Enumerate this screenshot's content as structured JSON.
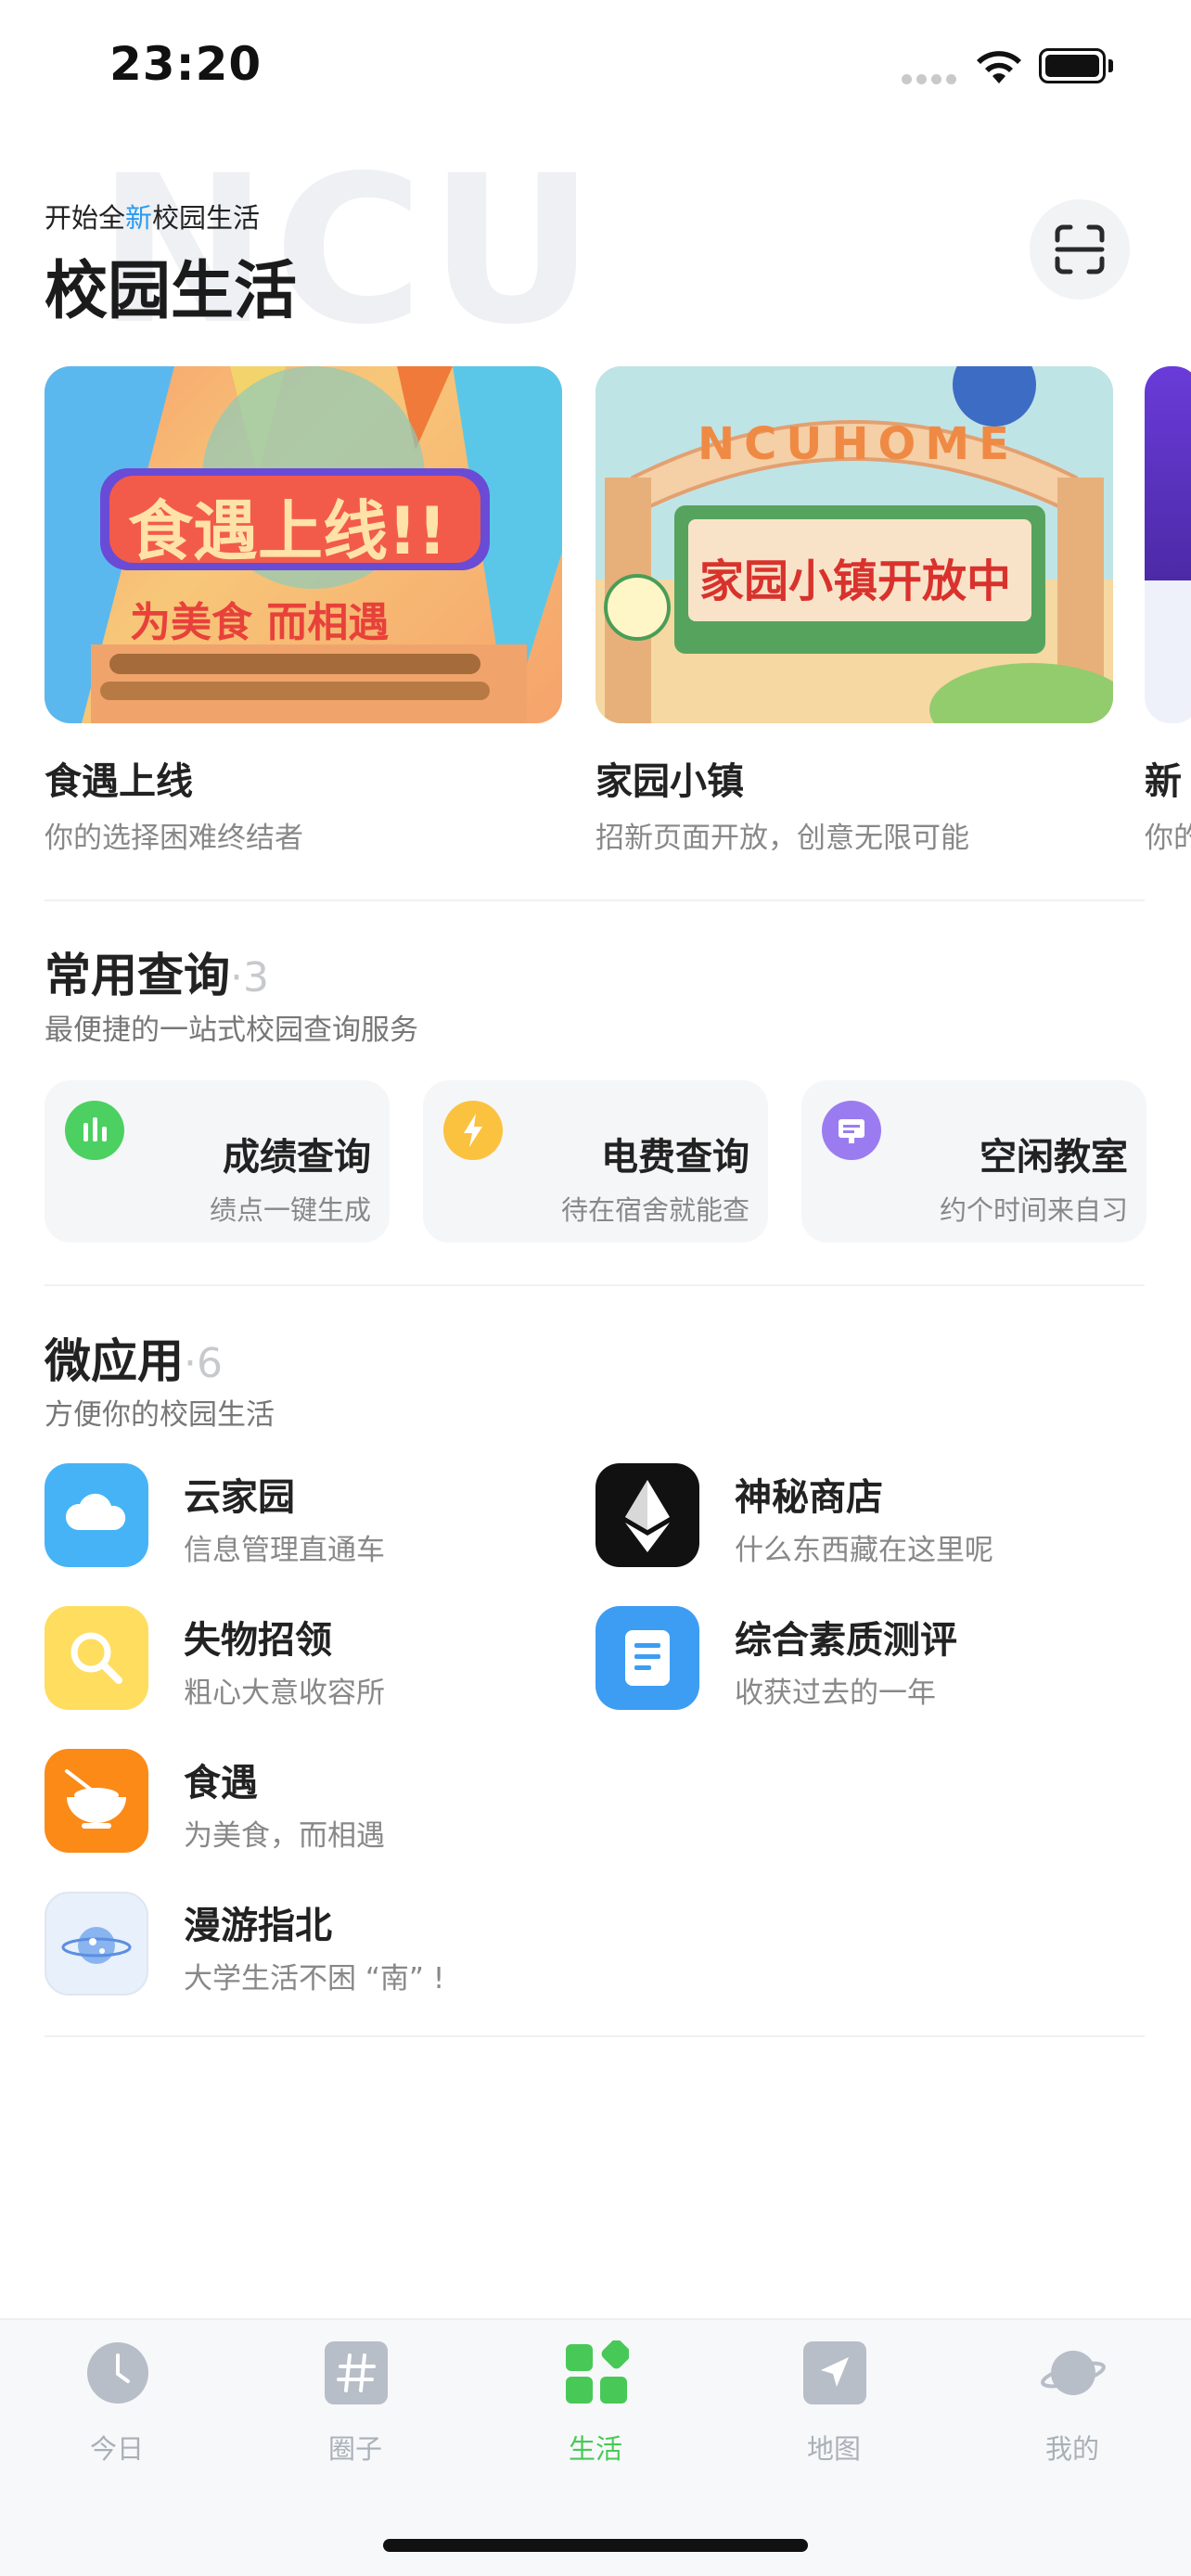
{
  "status_bar": {
    "time": "23:20"
  },
  "header": {
    "subtitle_pre": "开始全",
    "subtitle_highlight": "新",
    "subtitle_post": "校园生活",
    "watermark": "NCU",
    "title": "校园生活"
  },
  "banners": [
    {
      "title": "食遇上线",
      "subtitle": "你的选择困难终结者",
      "art_text_1": "食遇上线!!",
      "art_text_2": "为美食 而相遇"
    },
    {
      "title": "家园小镇",
      "subtitle": "招新页面开放，创意无限可能",
      "art_text_1": "NCUHOME",
      "art_text_2": "家园小镇开放中"
    },
    {
      "title": "新",
      "subtitle": "你的"
    }
  ],
  "queries": {
    "title": "常用查询",
    "count": "·3",
    "subtitle": "最便捷的一站式校园查询服务",
    "items": [
      {
        "title": "成绩查询",
        "subtitle": "绩点一键生成",
        "icon": "bar-chart-icon",
        "color": "#4cd062"
      },
      {
        "title": "电费查询",
        "subtitle": "待在宿舍就能查",
        "icon": "lightning-icon",
        "color": "#fbc23f"
      },
      {
        "title": "空闲教室",
        "subtitle": "约个时间来自习",
        "icon": "classroom-icon",
        "color": "#9b7cf0"
      }
    ]
  },
  "micro_apps": {
    "title": "微应用",
    "count": "·6",
    "subtitle": "方便你的校园生活",
    "items": [
      {
        "name": "云家园",
        "subtitle": "信息管理直通车",
        "icon": "cloud-icon",
        "color": "#46b3f6"
      },
      {
        "name": "神秘商店",
        "subtitle": "什么东西藏在这里呢",
        "icon": "ethereum-icon",
        "color": "#111111"
      },
      {
        "name": "失物招领",
        "subtitle": "粗心大意收容所",
        "icon": "search-icon",
        "color": "#fedd5f"
      },
      {
        "name": "综合素质测评",
        "subtitle": "收获过去的一年",
        "icon": "document-icon",
        "color": "#3d9df3"
      },
      {
        "name": "食遇",
        "subtitle": "为美食，而相遇",
        "icon": "bowl-icon",
        "color": "#fb8a17"
      },
      {
        "name": "漫游指北",
        "subtitle": "大学生活不困 “南” !",
        "icon": "planet-icon",
        "color": "#e8f0fc"
      }
    ]
  },
  "tabs": [
    {
      "label": "今日",
      "icon": "clock-icon",
      "active": false
    },
    {
      "label": "圈子",
      "icon": "hash-icon",
      "active": false
    },
    {
      "label": "生活",
      "icon": "grid-icon",
      "active": true
    },
    {
      "label": "地图",
      "icon": "navigation-icon",
      "active": false
    },
    {
      "label": "我的",
      "icon": "planet-icon",
      "active": false
    }
  ],
  "colors": {
    "accent": "#48c957",
    "highlight": "#2a9bf1"
  }
}
